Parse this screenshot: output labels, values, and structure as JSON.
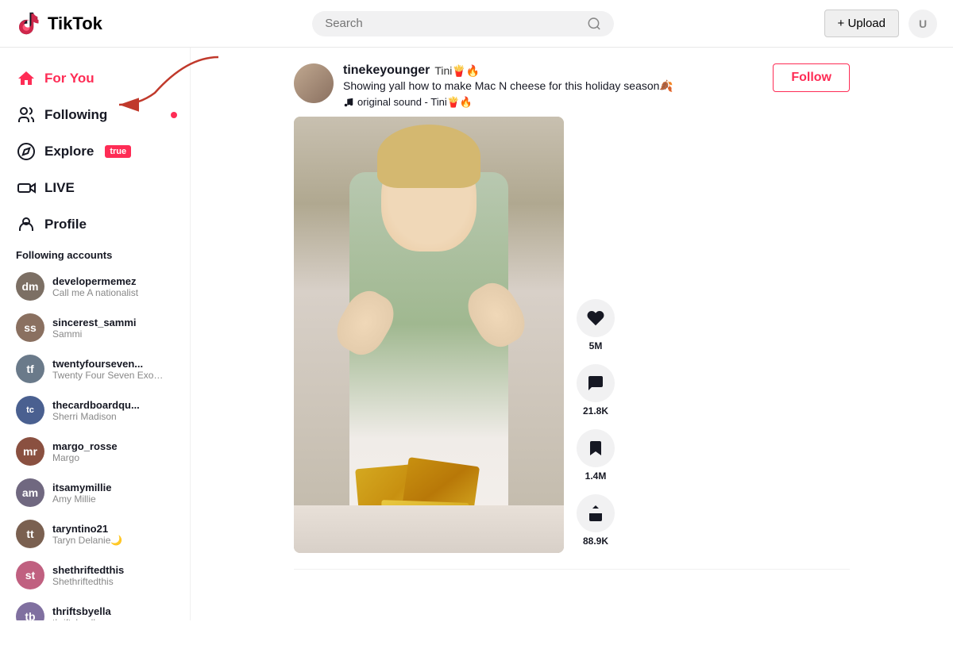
{
  "header": {
    "logo_text": "TikTok",
    "search_placeholder": "Search",
    "upload_label": "+ Upload"
  },
  "sidebar": {
    "nav_items": [
      {
        "id": "for-you",
        "label": "For You",
        "icon": "home",
        "active": true
      },
      {
        "id": "following",
        "label": "Following",
        "icon": "people",
        "active": false,
        "badge_dot": true
      },
      {
        "id": "explore",
        "label": "Explore",
        "icon": "compass",
        "active": false,
        "badge_new": true
      },
      {
        "id": "live",
        "label": "LIVE",
        "icon": "video",
        "active": false
      },
      {
        "id": "profile",
        "label": "Profile",
        "icon": "person",
        "active": false
      }
    ],
    "following_section_title": "Following accounts",
    "following_accounts": [
      {
        "id": "developermemez",
        "username": "developermemez",
        "display_name": "Call me A nationalist",
        "color": "#7c6f64"
      },
      {
        "id": "sincerest_sammi",
        "username": "sincerest_sammi",
        "display_name": "Sammi",
        "color": "#8a7060"
      },
      {
        "id": "twentyfourseven",
        "username": "twentyfourseven...",
        "display_name": "Twenty Four Seven Exoti...",
        "color": "#6a7a8a"
      },
      {
        "id": "thecardboardqu",
        "username": "thecardboardqu...",
        "display_name": "Sherri Madison",
        "color": "#4a6090"
      },
      {
        "id": "margo_rosse",
        "username": "margo_rosse",
        "display_name": "Margo",
        "color": "#8a5040"
      },
      {
        "id": "itsamymillie",
        "username": "itsamymillie",
        "display_name": "Amy Millie",
        "color": "#706880"
      },
      {
        "id": "taryntino21",
        "username": "taryntino21",
        "display_name": "Taryn Delanie🌙",
        "color": "#7a6050"
      },
      {
        "id": "shethriftedthis",
        "username": "shethriftedthis",
        "display_name": "Shethriftedthis",
        "color": "#c06080"
      },
      {
        "id": "thriftsbyella",
        "username": "thriftsbyella",
        "display_name": "thriftsbyella",
        "color": "#8070a0"
      }
    ]
  },
  "feed": {
    "item": {
      "username": "tinekeyounger",
      "username_meta": "Tini🍟🔥",
      "description": "Showing yall how to make Mac N cheese for this holiday season🍂",
      "sound_text": "original sound - Tini🍟🔥",
      "follow_label": "Follow",
      "likes": "5M",
      "comments": "21.8K",
      "bookmarks": "1.4M",
      "shares": "88.9K"
    }
  }
}
